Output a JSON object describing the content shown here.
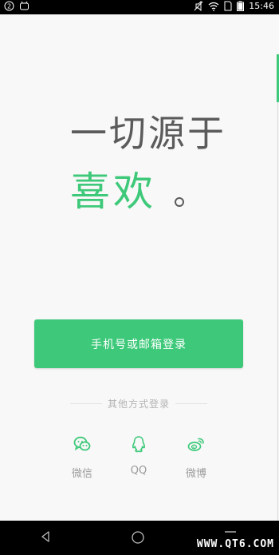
{
  "status_bar": {
    "notification_count": "2",
    "time": "15:46",
    "icons": [
      "notification-circle-icon",
      "android-icon",
      "mute-icon",
      "wifi-icon",
      "sim-icon",
      "battery-icon"
    ]
  },
  "hero": {
    "line1": "一切源于",
    "line2": "喜欢"
  },
  "login": {
    "button_label": "手机号或邮箱登录"
  },
  "other_login": {
    "divider_text": "其他方式登录",
    "options": [
      {
        "label": "微信",
        "icon": "wechat-icon"
      },
      {
        "label": "QQ",
        "icon": "qq-icon"
      },
      {
        "label": "微博",
        "icon": "weibo-icon"
      }
    ]
  },
  "nav_bar": {
    "buttons": [
      "back-icon",
      "home-icon",
      "recent-apps-icon"
    ]
  },
  "watermark": "WWW.QT6.COM",
  "colors": {
    "accent": "#3ec97a",
    "text_dark": "#5b5b5b",
    "text_muted": "#9a9a9a",
    "background": "#f8f8f8"
  }
}
